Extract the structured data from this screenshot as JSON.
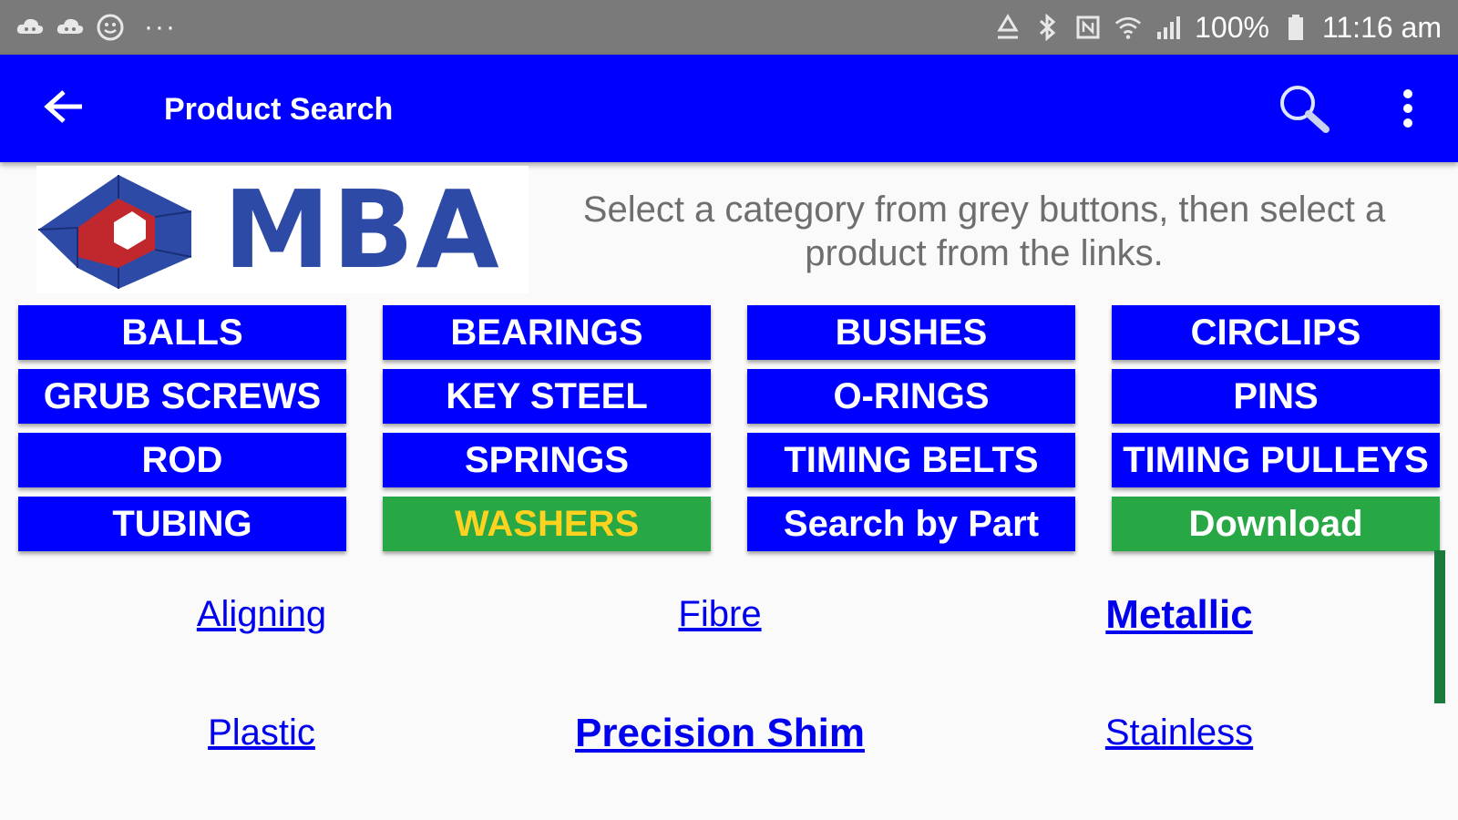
{
  "status_bar": {
    "left_icons": [
      "cloud-game-icon",
      "cloud-game-icon",
      "smiley-icon"
    ],
    "overflow": "···",
    "right_icons": [
      "recycle-icon",
      "bluetooth-icon",
      "nfc-icon",
      "wifi-icon",
      "signal-icon"
    ],
    "battery": "100%",
    "time": "11:16 am"
  },
  "appbar": {
    "title": "Product Search",
    "color": "#0000ff"
  },
  "header": {
    "logo_text": "MBA",
    "instructions": "Select a category from grey buttons, then select a product from the links."
  },
  "categories": [
    {
      "label": "BALLS"
    },
    {
      "label": "BEARINGS"
    },
    {
      "label": "BUSHES"
    },
    {
      "label": "CIRCLIPS"
    },
    {
      "label": "GRUB SCREWS"
    },
    {
      "label": "KEY STEEL"
    },
    {
      "label": "O-RINGS"
    },
    {
      "label": "PINS"
    },
    {
      "label": "ROD"
    },
    {
      "label": "SPRINGS"
    },
    {
      "label": "TIMING BELTS"
    },
    {
      "label": "TIMING PULLEYS"
    },
    {
      "label": "TUBING"
    },
    {
      "label": "WASHERS"
    },
    {
      "label": "Search by Part"
    },
    {
      "label": "Download"
    }
  ],
  "products": [
    {
      "label": "Aligning"
    },
    {
      "label": "Fibre"
    },
    {
      "label": "Metallic"
    },
    {
      "label": "Plastic"
    },
    {
      "label": "Precision Shim"
    },
    {
      "label": "Stainless"
    }
  ],
  "colors": {
    "button": "#0000ff",
    "active": "#28a745",
    "active_text": "#ffd21f",
    "link": "#0000ee"
  }
}
